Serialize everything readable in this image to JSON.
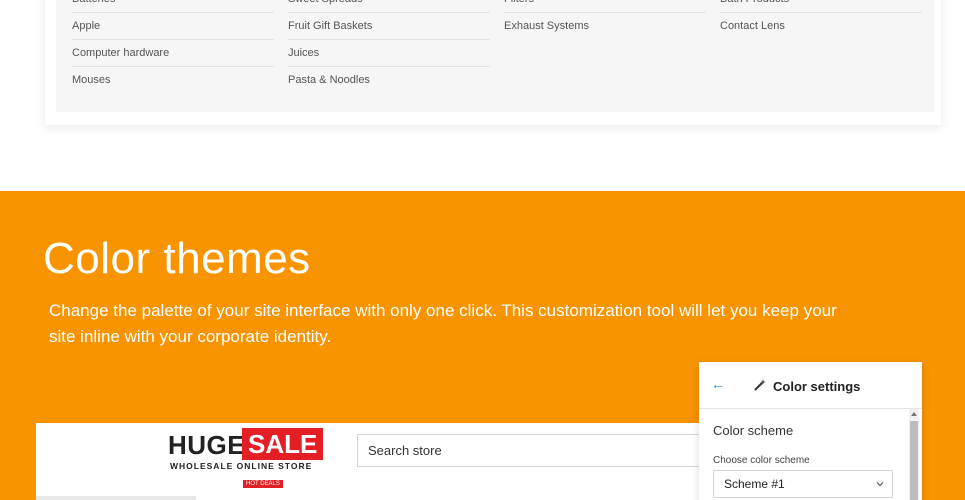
{
  "categories": {
    "col1": [
      "Batteries",
      "Apple",
      "Computer hardware",
      "Mouses"
    ],
    "col2": [
      "Sweet Spreads",
      "Fruit Gift Baskets",
      "Juices",
      "Pasta & Noodles"
    ],
    "col3": [
      "Filters",
      "Exhaust Systems"
    ],
    "col4": [
      "Bath Products",
      "Contact Lens"
    ]
  },
  "section": {
    "title": "Color themes",
    "description": "Change the palette of your site interface with only one click. This customization tool will let you keep your site inline with your corporate identity."
  },
  "store": {
    "logo_word_1": "HUGE",
    "logo_word_2": "SALE",
    "logo_tagline": "WHOLESALE ONLINE STORE",
    "hot_deals": "HOT DEALS",
    "search_placeholder": "Search store"
  },
  "panel": {
    "back_icon": "←",
    "title": "Color settings",
    "section_title": "Color scheme",
    "choose_label": "Choose color scheme",
    "selected_scheme": "Scheme #1"
  },
  "colors": {
    "accent_orange": "#f79400",
    "brand_red": "#e31e24",
    "link_blue": "#2e8bd6"
  }
}
